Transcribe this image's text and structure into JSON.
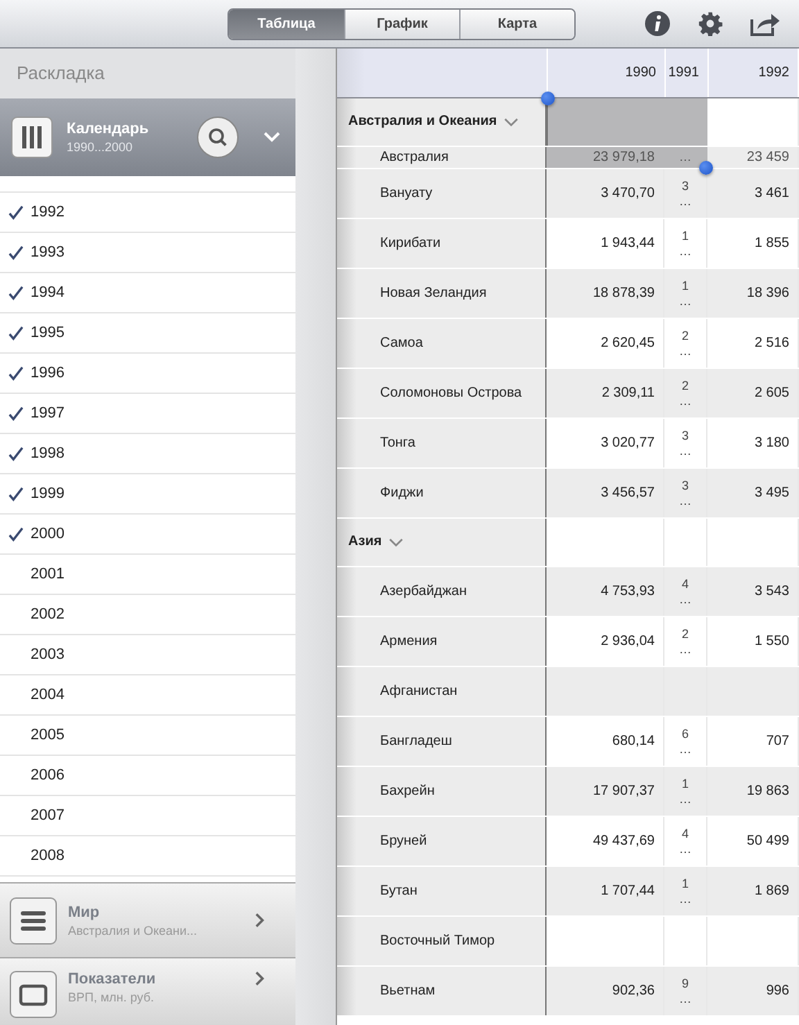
{
  "toolbar": {
    "tabs": [
      {
        "label": "Таблица",
        "selected": true
      },
      {
        "label": "График",
        "selected": false
      },
      {
        "label": "Карта",
        "selected": false
      }
    ]
  },
  "sidebar": {
    "title": "Раскладка",
    "calendar": {
      "title": "Календарь",
      "subtitle": "1990...2000"
    },
    "years": [
      {
        "label": "1992",
        "checked": true
      },
      {
        "label": "1993",
        "checked": true
      },
      {
        "label": "1994",
        "checked": true
      },
      {
        "label": "1995",
        "checked": true
      },
      {
        "label": "1996",
        "checked": true
      },
      {
        "label": "1997",
        "checked": true
      },
      {
        "label": "1998",
        "checked": true
      },
      {
        "label": "1999",
        "checked": true
      },
      {
        "label": "2000",
        "checked": true
      },
      {
        "label": "2001",
        "checked": false
      },
      {
        "label": "2002",
        "checked": false
      },
      {
        "label": "2003",
        "checked": false
      },
      {
        "label": "2004",
        "checked": false
      },
      {
        "label": "2005",
        "checked": false
      },
      {
        "label": "2006",
        "checked": false
      },
      {
        "label": "2007",
        "checked": false
      },
      {
        "label": "2008",
        "checked": false
      }
    ],
    "panels": [
      {
        "kind": "list",
        "title": "Мир",
        "subtitle": "Австралия и Океани..."
      },
      {
        "kind": "frame",
        "title": "Показатели",
        "subtitle": "ВРП, млн. руб."
      }
    ]
  },
  "table": {
    "columns": [
      "1990",
      "1991",
      "1992"
    ],
    "rows": [
      {
        "kind": "group",
        "name": "Австралия и Океания",
        "expanded": true,
        "selected": true
      },
      {
        "kind": "pinned",
        "name": "Австралия",
        "selected": true,
        "values": [
          "23 979,18",
          "…",
          "23 459"
        ]
      },
      {
        "kind": "item",
        "name": "Вануату",
        "selected": false,
        "values": [
          "3 470,70",
          "3 …",
          "3 461"
        ]
      },
      {
        "kind": "item",
        "name": "Кирибати",
        "selected": false,
        "values": [
          "1 943,44",
          "1 …",
          "1 855"
        ]
      },
      {
        "kind": "item",
        "name": "Новая Зеландия",
        "selected": false,
        "values": [
          "18 878,39",
          "1 …",
          "18 396"
        ]
      },
      {
        "kind": "item",
        "name": "Самоа",
        "selected": false,
        "values": [
          "2 620,45",
          "2 …",
          "2 516"
        ]
      },
      {
        "kind": "item",
        "name": "Соломоновы Острова",
        "selected": false,
        "values": [
          "2 309,11",
          "2 …",
          "2 605"
        ]
      },
      {
        "kind": "item",
        "name": "Тонга",
        "selected": false,
        "values": [
          "3 020,77",
          "3 …",
          "3 180"
        ]
      },
      {
        "kind": "item",
        "name": "Фиджи",
        "selected": false,
        "values": [
          "3 456,57",
          "3 …",
          "3 495"
        ]
      },
      {
        "kind": "group",
        "name": "Азия",
        "expanded": true,
        "selected": false
      },
      {
        "kind": "item",
        "name": "Азербайджан",
        "selected": false,
        "values": [
          "4 753,93",
          "4 …",
          "3 543"
        ]
      },
      {
        "kind": "item",
        "name": "Армения",
        "selected": false,
        "values": [
          "2 936,04",
          "2 …",
          "1 550"
        ]
      },
      {
        "kind": "item",
        "name": "Афганистан",
        "selected": false
      },
      {
        "kind": "item",
        "name": "Бангладеш",
        "selected": false,
        "values": [
          "680,14",
          "6 …",
          "707"
        ]
      },
      {
        "kind": "item",
        "name": "Бахрейн",
        "selected": false,
        "values": [
          "17 907,37",
          "1 …",
          "19 863"
        ]
      },
      {
        "kind": "item",
        "name": "Бруней",
        "selected": false,
        "values": [
          "49 437,69",
          "4 …",
          "50 499"
        ]
      },
      {
        "kind": "item",
        "name": "Бутан",
        "selected": false,
        "values": [
          "1 707,44",
          "1 …",
          "1 869"
        ]
      },
      {
        "kind": "item",
        "name": "Восточный Тимор",
        "selected": false
      },
      {
        "kind": "item",
        "name": "Вьетнам",
        "selected": false,
        "values": [
          "902,36",
          "9 …",
          "996"
        ]
      }
    ]
  }
}
